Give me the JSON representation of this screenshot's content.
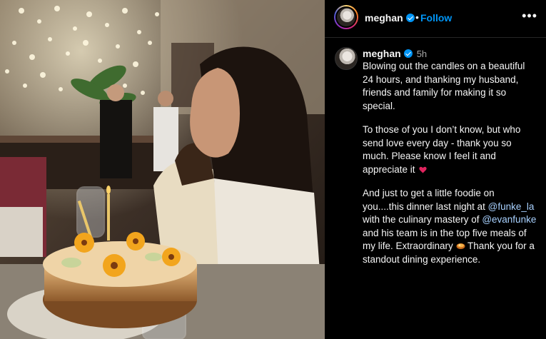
{
  "post": {
    "username": "meghan",
    "follow_label": "Follow",
    "separator": "•",
    "more_label": "•••",
    "timestamp": "5h",
    "caption": {
      "p1": "Blowing out the candles on a beautiful 24 hours, and thanking my husband, friends and family for making it so special.",
      "p2": "To those of you I don’t know, but who send love every day - thank you so much. Please know I feel it and appreciate it",
      "p3_a": "And just to get a little foodie on you....this dinner last night at ",
      "mention1": "@funke_la",
      "p3_b": " with the culinary mastery of ",
      "mention2": "@evanfunke",
      "p3_c": " and his team is in the top five meals of my life. Extraordinary ",
      "p3_d": " Thank you for a standout dining experience."
    }
  },
  "icons": {
    "verified": "verified-badge-icon",
    "heart": "red-heart-emoji",
    "dish": "shallow-pan-food-emoji",
    "more": "more-options-icon"
  },
  "colors": {
    "background": "#000000",
    "accent_link": "#0095f6",
    "verified": "#0095f6",
    "heart": "#e0245e"
  }
}
